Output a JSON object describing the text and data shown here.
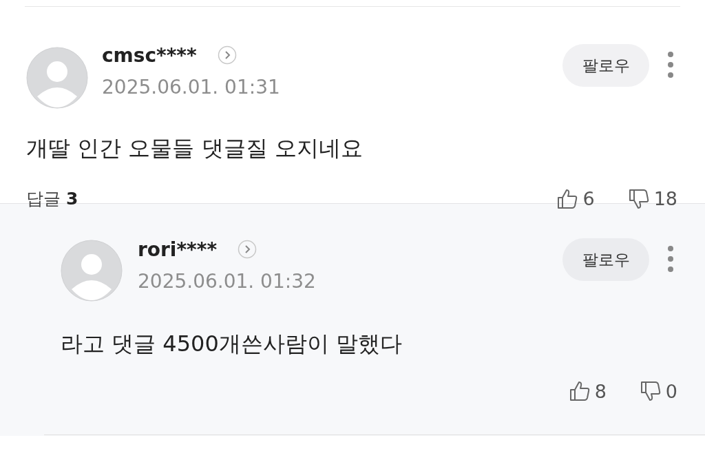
{
  "comments": [
    {
      "kind": "comment",
      "author": "cmsc****",
      "date": "2025.06.01. 01:31",
      "follow": "팔로우",
      "text": "개딸 인간 오물들 댓글질 오지네요",
      "replies_label": "답글",
      "replies_count": "3",
      "likes": "6",
      "dislikes": "18"
    },
    {
      "kind": "reply",
      "author": "rori****",
      "date": "2025.06.01. 01:32",
      "follow": "팔로우",
      "text": "라고 댓글 4500개쓴사람이 말했다",
      "likes": "8",
      "dislikes": "0"
    }
  ]
}
